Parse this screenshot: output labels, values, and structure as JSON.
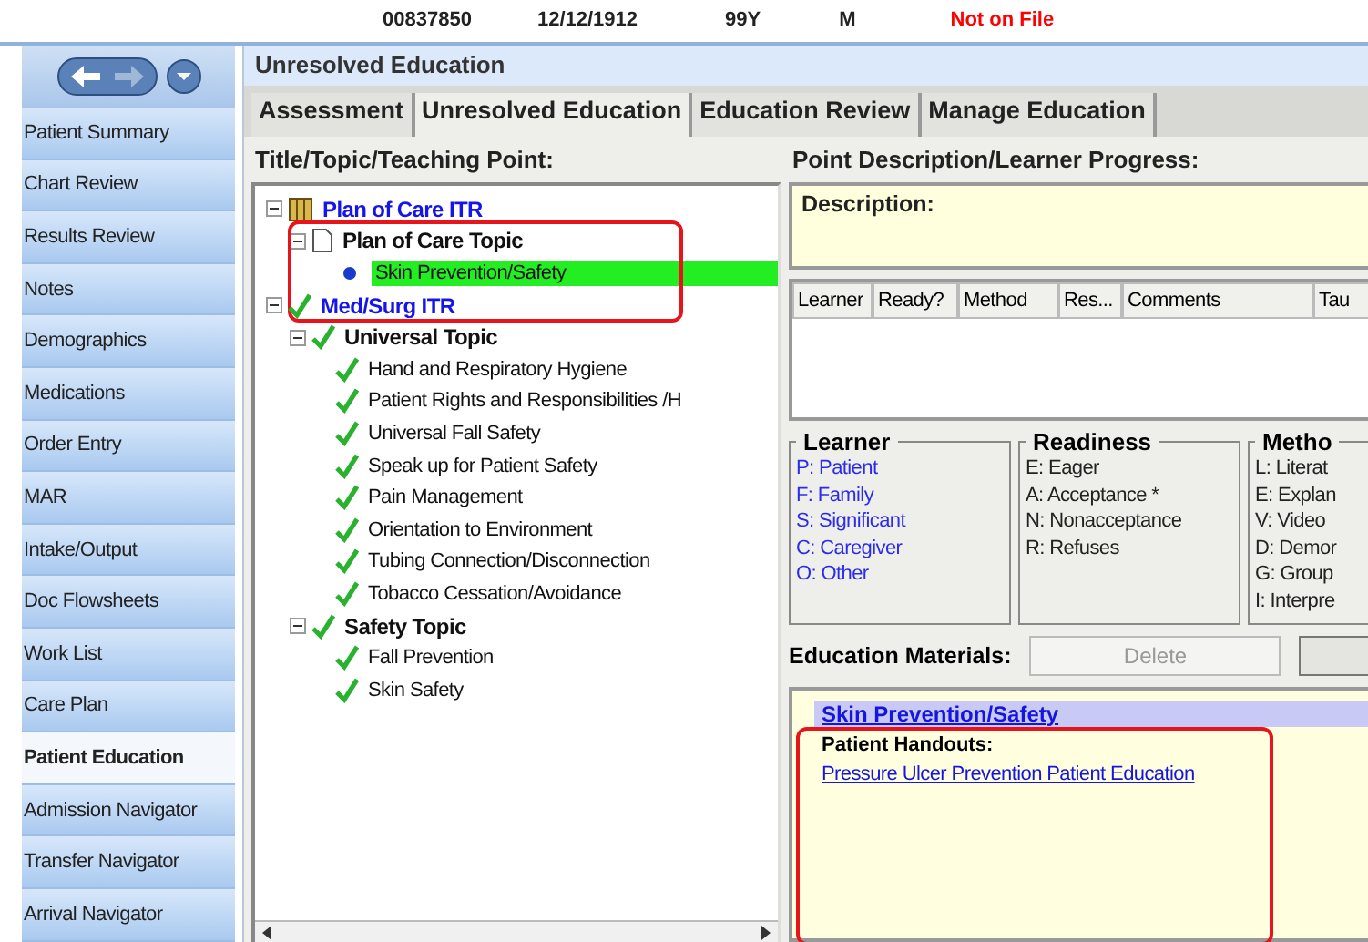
{
  "header": {
    "fields": [
      {
        "text": "00837850",
        "kind": "plain"
      },
      {
        "text": "12/12/1912",
        "kind": "plain"
      },
      {
        "text": "99Y",
        "kind": "plain"
      },
      {
        "text": "M",
        "kind": "plain"
      },
      {
        "text": "Not on File",
        "kind": "alert"
      }
    ]
  },
  "sidebar": {
    "items": [
      {
        "label": "Patient Summary",
        "selected": false
      },
      {
        "label": "Chart Review",
        "selected": false
      },
      {
        "label": "Results Review",
        "selected": false
      },
      {
        "label": "Notes",
        "selected": false
      },
      {
        "label": "Demographics",
        "selected": false
      },
      {
        "label": "Medications",
        "selected": false
      },
      {
        "label": "Order Entry",
        "selected": false
      },
      {
        "label": "MAR",
        "selected": false
      },
      {
        "label": "Intake/Output",
        "selected": false
      },
      {
        "label": "Doc Flowsheets",
        "selected": false
      },
      {
        "label": "Work List",
        "selected": false
      },
      {
        "label": "Care Plan",
        "selected": false
      },
      {
        "label": "Patient Education",
        "selected": true
      },
      {
        "label": "Admission Navigator",
        "selected": false
      },
      {
        "label": "Transfer Navigator",
        "selected": false
      },
      {
        "label": "Arrival Navigator",
        "selected": false
      }
    ]
  },
  "window": {
    "title": "Unresolved Education"
  },
  "tabs": [
    {
      "label": "Assessment",
      "selected": false
    },
    {
      "label": "Unresolved Education",
      "selected": true
    },
    {
      "label": "Education Review",
      "selected": false
    },
    {
      "label": "Manage Education",
      "selected": false
    }
  ],
  "tree": {
    "heading": "Title/Topic/Teaching Point:",
    "items": [
      {
        "label": "Plan of Care ITR",
        "kind": "title",
        "done": false,
        "selected": false,
        "children": [
          {
            "label": "Plan of Care Topic",
            "kind": "topic",
            "done": false,
            "selected": false,
            "children": [
              {
                "label": "Skin Prevention/Safety",
                "kind": "point",
                "done": false,
                "selected": true,
                "annotated": true
              }
            ]
          }
        ]
      },
      {
        "label": "Med/Surg ITR",
        "kind": "title",
        "done": true,
        "selected": false,
        "children": [
          {
            "label": "Universal Topic",
            "kind": "topic",
            "done": true,
            "selected": false,
            "children": [
              {
                "label": "Hand and Respiratory Hygiene",
                "kind": "point",
                "done": true,
                "selected": false
              },
              {
                "label": "Patient Rights and Responsibilities /H",
                "kind": "point",
                "done": true,
                "selected": false
              },
              {
                "label": "Universal Fall Safety",
                "kind": "point",
                "done": true,
                "selected": false
              },
              {
                "label": "Speak up for Patient Safety",
                "kind": "point",
                "done": true,
                "selected": false
              },
              {
                "label": "Pain Management",
                "kind": "point",
                "done": true,
                "selected": false
              },
              {
                "label": "Orientation to Environment",
                "kind": "point",
                "done": true,
                "selected": false
              },
              {
                "label": "Tubing Connection/Disconnection",
                "kind": "point",
                "done": true,
                "selected": false
              },
              {
                "label": "Tobacco Cessation/Avoidance",
                "kind": "point",
                "done": true,
                "selected": false
              }
            ]
          },
          {
            "label": "Safety Topic",
            "kind": "topic",
            "done": true,
            "selected": false,
            "children": [
              {
                "label": "Fall Prevention",
                "kind": "point",
                "done": true,
                "selected": false
              },
              {
                "label": "Skin Safety",
                "kind": "point",
                "done": true,
                "selected": false
              }
            ]
          }
        ]
      }
    ]
  },
  "detail": {
    "heading": "Point Description/Learner Progress:",
    "description_label": "Description:",
    "grid_columns": [
      "Learner",
      "Ready?",
      "Method",
      "Res...",
      "Comments",
      "Tau"
    ],
    "legends": [
      {
        "title": "Learner",
        "kind": "link",
        "items": [
          "P: Patient",
          "F: Family",
          "S: Significant",
          "C: Caregiver",
          "O: Other"
        ]
      },
      {
        "title": "Readiness",
        "kind": "plain",
        "items": [
          "E: Eager",
          "A: Acceptance *",
          "N: Nonacceptance",
          "R: Refuses"
        ]
      },
      {
        "title": "Metho",
        "kind": "plain",
        "items": [
          "L: Literat",
          "E: Explan",
          "V: Video",
          "D: Demor",
          "G: Group",
          "I: Interpre"
        ]
      }
    ],
    "materials": {
      "label": "Education Materials:",
      "buttons": [
        {
          "label": "Delete",
          "disabled": true
        },
        {
          "disabled": false
        }
      ],
      "selected_item": "Skin Prevention/Safety",
      "handouts_label": "Patient Handouts:",
      "handout_link": "Pressure Ulcer Prevention Patient Education",
      "annotated": true
    }
  }
}
